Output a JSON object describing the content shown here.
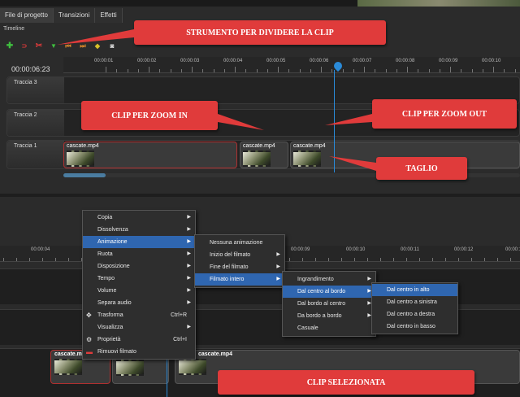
{
  "tabs": [
    "File di progetto",
    "Transizioni",
    "Effetti"
  ],
  "timeline_title": "Timeline",
  "timecode": "00:00:06:23",
  "ruler_top": [
    "00:00:01",
    "00:00:02",
    "00:00:03",
    "00:00:04",
    "00:00:05",
    "00:00:06",
    "00:00:07",
    "00:00:08",
    "00:00:09",
    "00:00:10"
  ],
  "tracks": [
    "Traccia 3",
    "Traccia 2",
    "Traccia 1"
  ],
  "clips_top": [
    "cascate.mp4",
    "cascate.mp4",
    "cascate.mp4"
  ],
  "callouts": {
    "split": "STRUMENTO PER DIVIDERE LA CLIP",
    "zoom_in": "CLIP PER ZOOM IN",
    "zoom_out": "CLIP PER ZOOM OUT",
    "cut": "TAGLIO",
    "selected": "CLIP SELEZIONATA"
  },
  "ruler_bottom": [
    "00:00:04",
    "00:00:09",
    "00:00:10",
    "00:00:11",
    "00:00:12",
    "00:00:13"
  ],
  "clips_bottom": [
    "cascate.mp4",
    "cascate.mp4"
  ],
  "context_menu": [
    {
      "label": "Copia",
      "arrow": true
    },
    {
      "label": "Dissolvenza",
      "arrow": true
    },
    {
      "label": "Animazione",
      "arrow": true,
      "highlight": true
    },
    {
      "label": "Ruota",
      "arrow": true
    },
    {
      "label": "Disposizione",
      "arrow": true
    },
    {
      "label": "Tempo",
      "arrow": true
    },
    {
      "label": "Volume",
      "arrow": true
    },
    {
      "label": "Separa audio",
      "arrow": true
    },
    {
      "label": "Trasforma",
      "shortcut": "Ctrl+R",
      "icon": "move-icon"
    },
    {
      "label": "Visualizza",
      "arrow": true
    },
    {
      "label": "Proprietà",
      "shortcut": "Ctrl+I",
      "icon": "gear-icon"
    },
    {
      "label": "Rimuovi filmato",
      "icon": "remove-icon"
    }
  ],
  "submenu_animazione": [
    {
      "label": "Nessuna animazione"
    },
    {
      "label": "Inizio del filmato",
      "arrow": true
    },
    {
      "label": "Fine del filmato",
      "arrow": true
    },
    {
      "label": "Filmato intero",
      "arrow": true,
      "highlight": true
    }
  ],
  "submenu_filmato": [
    {
      "label": "Ingrandimento",
      "arrow": true
    },
    {
      "label": "Dal centro al bordo",
      "arrow": true,
      "highlight": true
    },
    {
      "label": "Dal bordo al centro",
      "arrow": true
    },
    {
      "label": "Da bordo a bordo",
      "arrow": true
    },
    {
      "label": "Casuale"
    }
  ],
  "submenu_centro": [
    {
      "label": "Dal centro in alto",
      "highlight": true
    },
    {
      "label": "Dal centro a sinistra"
    },
    {
      "label": "Dal centro a destra"
    },
    {
      "label": "Dal centro in basso"
    }
  ],
  "colors": {
    "callout": "#e03b3b",
    "accent": "#2f66b0",
    "playhead": "#2a8ad8"
  }
}
